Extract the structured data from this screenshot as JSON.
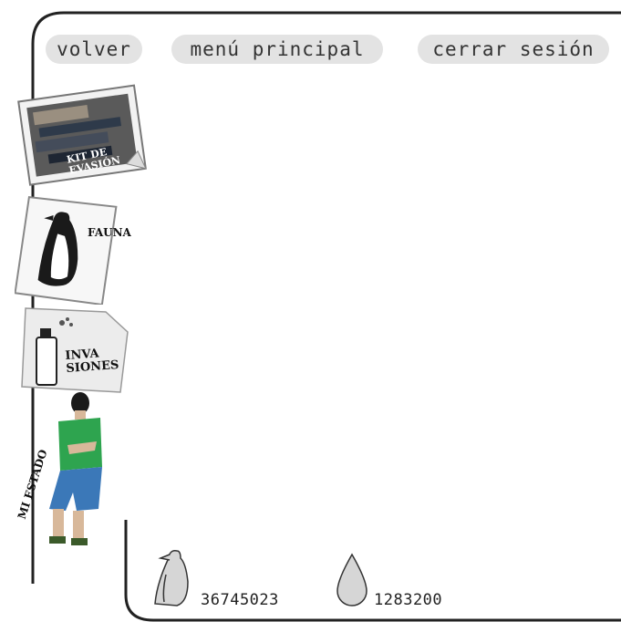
{
  "nav": {
    "back_label": "volver",
    "main_menu_label": "menú principal",
    "logout_label": "cerrar sesión"
  },
  "sidebar": {
    "items": [
      {
        "id": "kit",
        "label_line1": "KIT DE",
        "label_line2": "EVASIÓN",
        "icon": "tools-kit-icon"
      },
      {
        "id": "fauna",
        "label": "FAUNA",
        "icon": "penguin-icon"
      },
      {
        "id": "invasiones",
        "label_line1": "INVA",
        "label_line2": "SIONES",
        "icon": "spray-can-icon"
      },
      {
        "id": "estado",
        "label": "MI ESTADO",
        "icon": "avatar-icon"
      }
    ]
  },
  "stats": {
    "penguins_value": "36745023",
    "drops_value": "1283200",
    "penguins_icon": "penguin-icon",
    "drops_icon": "water-drop-icon"
  },
  "colors": {
    "pill_bg": "#e3e3e3",
    "frame": "#222222"
  }
}
